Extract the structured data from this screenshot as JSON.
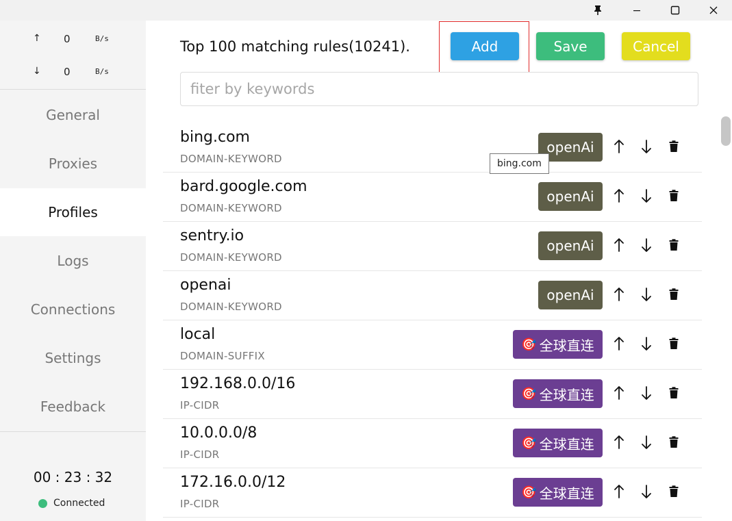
{
  "sidebar": {
    "upload": {
      "arrow": "↑",
      "value": "0",
      "unit": "B/s"
    },
    "download": {
      "arrow": "↓",
      "value": "0",
      "unit": "B/s"
    },
    "nav": [
      {
        "label": "General"
      },
      {
        "label": "Proxies"
      },
      {
        "label": "Profiles"
      },
      {
        "label": "Logs"
      },
      {
        "label": "Connections"
      },
      {
        "label": "Settings"
      },
      {
        "label": "Feedback"
      }
    ],
    "active_index": 2,
    "timer": "00 : 23 : 32",
    "status": "Connected",
    "status_color": "#3dbd7d"
  },
  "main": {
    "title": "Top 100 matching rules(10241).",
    "add_label": "Add",
    "save_label": "Save",
    "cancel_label": "Cancel",
    "search_placeholder": "fiter by keywords",
    "tooltip": "bing.com",
    "rules": [
      {
        "name": "bing.com",
        "type": "DOMAIN-KEYWORD",
        "policy": "openAi",
        "policy_style": "olive"
      },
      {
        "name": "bard.google.com",
        "type": "DOMAIN-KEYWORD",
        "policy": "openAi",
        "policy_style": "olive"
      },
      {
        "name": "sentry.io",
        "type": "DOMAIN-KEYWORD",
        "policy": "openAi",
        "policy_style": "olive"
      },
      {
        "name": "openai",
        "type": "DOMAIN-KEYWORD",
        "policy": "openAi",
        "policy_style": "olive"
      },
      {
        "name": "local",
        "type": "DOMAIN-SUFFIX",
        "policy": "全球直连",
        "policy_icon": "🎯",
        "policy_style": "purple"
      },
      {
        "name": "192.168.0.0/16",
        "type": "IP-CIDR",
        "policy": "全球直连",
        "policy_icon": "🎯",
        "policy_style": "purple"
      },
      {
        "name": "10.0.0.0/8",
        "type": "IP-CIDR",
        "policy": "全球直连",
        "policy_icon": "🎯",
        "policy_style": "purple"
      },
      {
        "name": "172.16.0.0/12",
        "type": "IP-CIDR",
        "policy": "全球直连",
        "policy_icon": "🎯",
        "policy_style": "purple"
      }
    ]
  },
  "icons": {
    "pin": "pin-icon",
    "minimize": "minimize-icon",
    "maximize": "maximize-icon",
    "close": "close-icon",
    "move_up": "arrow-up-icon",
    "move_down": "arrow-down-icon",
    "delete": "trash-icon"
  }
}
